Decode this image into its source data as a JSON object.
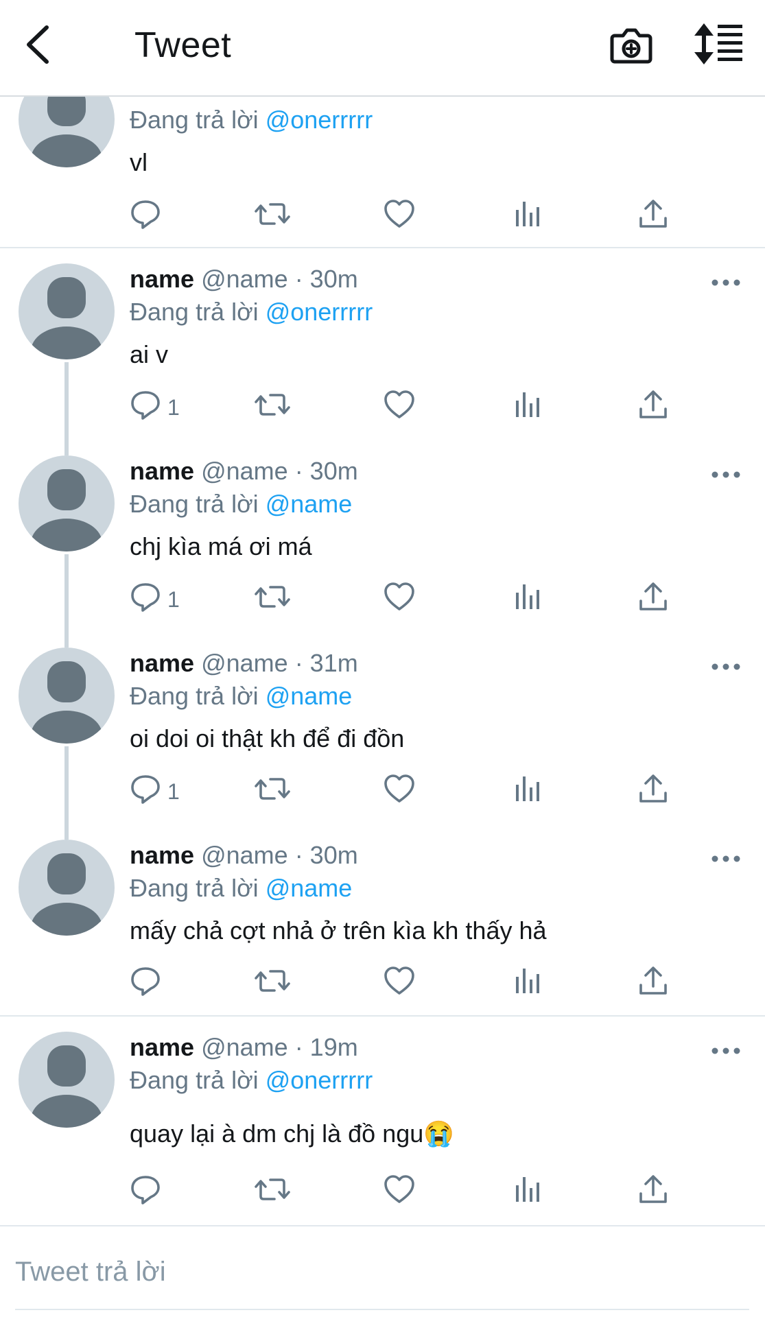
{
  "header": {
    "title": "Tweet"
  },
  "tweets": [
    {
      "name": "",
      "handle": "",
      "time": "",
      "replying_prefix": "Đang trả lời ",
      "replying_to": "@onerrrrr",
      "text": "vl",
      "reply_count": ""
    },
    {
      "name": "name",
      "handle": "@name",
      "time": "· 30m",
      "replying_prefix": "Đang trả lời ",
      "replying_to": "@onerrrrr",
      "text": "ai v",
      "reply_count": "1"
    },
    {
      "name": "name",
      "handle": "@name",
      "time": "· 30m",
      "replying_prefix": "Đang trả lời ",
      "replying_to": "@name",
      "text": "chj kìa má ơi má",
      "reply_count": "1"
    },
    {
      "name": "name",
      "handle": "@name",
      "time": "· 31m",
      "replying_prefix": "Đang trả lời ",
      "replying_to": "@name",
      "text": "oi doi oi thật kh để đi đồn",
      "reply_count": "1"
    },
    {
      "name": "name",
      "handle": "@name",
      "time": "· 30m",
      "replying_prefix": "Đang trả lời ",
      "replying_to": "@name",
      "text": "mấy chả cợt nhả ở trên kìa kh thấy hả",
      "reply_count": ""
    },
    {
      "name": "name",
      "handle": "@name",
      "time": "· 19m",
      "replying_prefix": "Đang trả lời ",
      "replying_to": "@onerrrrr",
      "text": "quay lại à dm chj là đồ ngu😭",
      "reply_count": ""
    }
  ],
  "reply_bar": {
    "placeholder": "Tweet trả lời"
  },
  "icons": {
    "back": "chevron-left-icon",
    "camera": "camera-plus-icon",
    "sort": "sort-icon",
    "more": "more-horizontal-icon",
    "reply": "reply-bubble-icon",
    "retweet": "retweet-icon",
    "like": "heart-icon",
    "analytics": "analytics-icon",
    "share": "share-icon"
  },
  "colors": {
    "accent": "#1da1f2",
    "text": "#14171a",
    "secondary": "#657786",
    "avatar_bg": "#ccd6dd",
    "avatar_fg": "#66757f"
  }
}
